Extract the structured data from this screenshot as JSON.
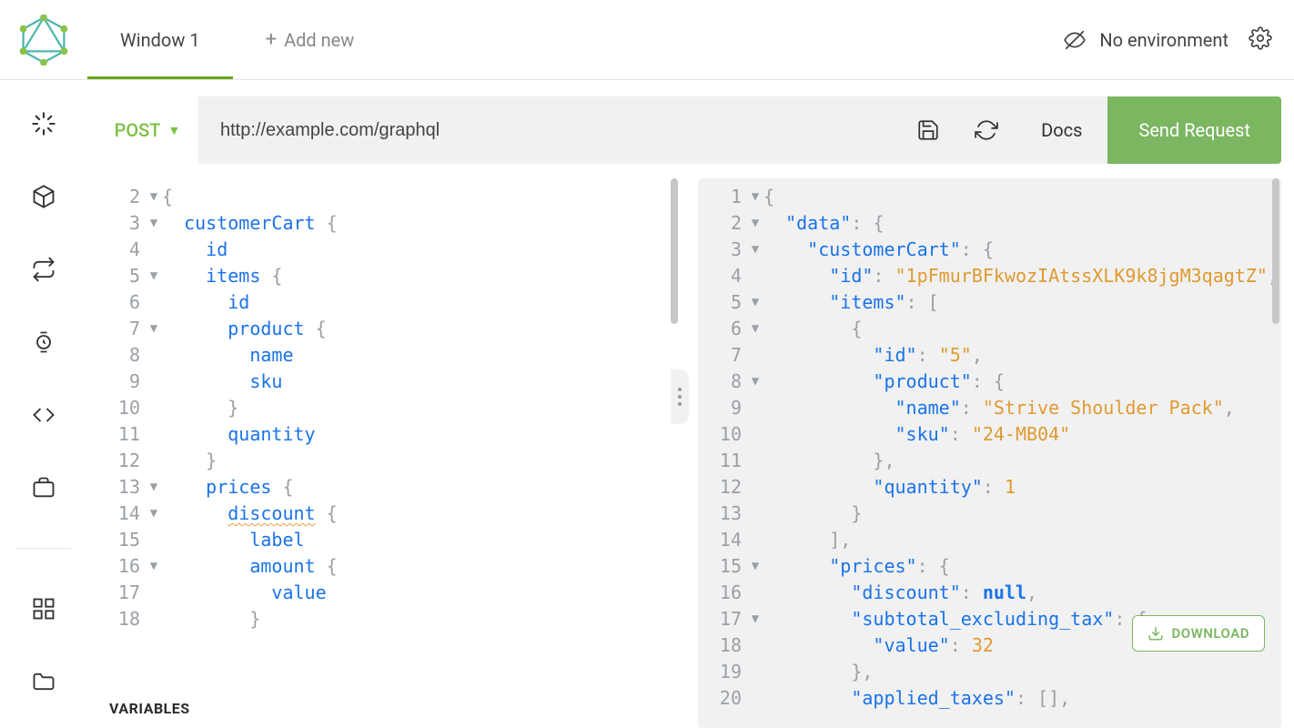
{
  "tabs": {
    "active": "Window 1",
    "add_new_label": "Add new"
  },
  "environment": {
    "label": "No environment"
  },
  "urlbar": {
    "method": "POST",
    "url": "http://example.com/graphql",
    "docs_label": "Docs",
    "send_label": "Send Request"
  },
  "variables_label": "VARIABLES",
  "download_label": "DOWNLOAD",
  "query_lines": [
    {
      "n": 2,
      "fold": true,
      "tokens": [
        {
          "t": "{",
          "c": "pu"
        }
      ]
    },
    {
      "n": 3,
      "fold": true,
      "tokens": [
        {
          "t": "  ",
          "c": ""
        },
        {
          "t": "customerCart",
          "c": "p"
        },
        {
          "t": " {",
          "c": "pu"
        }
      ]
    },
    {
      "n": 4,
      "fold": false,
      "tokens": [
        {
          "t": "    ",
          "c": ""
        },
        {
          "t": "id",
          "c": "p"
        }
      ]
    },
    {
      "n": 5,
      "fold": true,
      "tokens": [
        {
          "t": "    ",
          "c": ""
        },
        {
          "t": "items",
          "c": "p"
        },
        {
          "t": " {",
          "c": "pu"
        }
      ]
    },
    {
      "n": 6,
      "fold": false,
      "tokens": [
        {
          "t": "      ",
          "c": ""
        },
        {
          "t": "id",
          "c": "p"
        }
      ]
    },
    {
      "n": 7,
      "fold": true,
      "tokens": [
        {
          "t": "      ",
          "c": ""
        },
        {
          "t": "product",
          "c": "p"
        },
        {
          "t": " {",
          "c": "pu"
        }
      ]
    },
    {
      "n": 8,
      "fold": false,
      "tokens": [
        {
          "t": "        ",
          "c": ""
        },
        {
          "t": "name",
          "c": "p"
        }
      ]
    },
    {
      "n": 9,
      "fold": false,
      "tokens": [
        {
          "t": "        ",
          "c": ""
        },
        {
          "t": "sku",
          "c": "p"
        }
      ]
    },
    {
      "n": 10,
      "fold": false,
      "tokens": [
        {
          "t": "      ",
          "c": ""
        },
        {
          "t": "}",
          "c": "pu"
        }
      ]
    },
    {
      "n": 11,
      "fold": false,
      "tokens": [
        {
          "t": "      ",
          "c": ""
        },
        {
          "t": "quantity",
          "c": "p"
        }
      ]
    },
    {
      "n": 12,
      "fold": false,
      "tokens": [
        {
          "t": "    ",
          "c": ""
        },
        {
          "t": "}",
          "c": "pu"
        }
      ]
    },
    {
      "n": 13,
      "fold": true,
      "tokens": [
        {
          "t": "    ",
          "c": ""
        },
        {
          "t": "prices",
          "c": "p"
        },
        {
          "t": " {",
          "c": "pu"
        }
      ]
    },
    {
      "n": 14,
      "fold": true,
      "tokens": [
        {
          "t": "      ",
          "c": ""
        },
        {
          "t": "discount",
          "c": "p",
          "u": true
        },
        {
          "t": " {",
          "c": "pu"
        }
      ]
    },
    {
      "n": 15,
      "fold": false,
      "tokens": [
        {
          "t": "        ",
          "c": ""
        },
        {
          "t": "label",
          "c": "p"
        }
      ]
    },
    {
      "n": 16,
      "fold": true,
      "tokens": [
        {
          "t": "        ",
          "c": ""
        },
        {
          "t": "amount",
          "c": "p"
        },
        {
          "t": " {",
          "c": "pu"
        }
      ]
    },
    {
      "n": 17,
      "fold": false,
      "tokens": [
        {
          "t": "          ",
          "c": ""
        },
        {
          "t": "value",
          "c": "p"
        }
      ]
    },
    {
      "n": 18,
      "fold": false,
      "tokens": [
        {
          "t": "        ",
          "c": ""
        },
        {
          "t": "}",
          "c": "pu"
        }
      ]
    }
  ],
  "response_lines": [
    {
      "n": 1,
      "fold": true,
      "tokens": [
        {
          "t": "{",
          "c": "pu"
        }
      ]
    },
    {
      "n": 2,
      "fold": true,
      "tokens": [
        {
          "t": "  ",
          "c": ""
        },
        {
          "t": "\"data\"",
          "c": "k"
        },
        {
          "t": ": {",
          "c": "pu"
        }
      ]
    },
    {
      "n": 3,
      "fold": true,
      "tokens": [
        {
          "t": "    ",
          "c": ""
        },
        {
          "t": "\"customerCart\"",
          "c": "k"
        },
        {
          "t": ": {",
          "c": "pu"
        }
      ]
    },
    {
      "n": 4,
      "fold": false,
      "tokens": [
        {
          "t": "      ",
          "c": ""
        },
        {
          "t": "\"id\"",
          "c": "k"
        },
        {
          "t": ": ",
          "c": "pu"
        },
        {
          "t": "\"1pFmurBFkwozIAtssXLK9k8jgM3qagtZ\"",
          "c": "s"
        },
        {
          "t": ",",
          "c": "pu"
        }
      ]
    },
    {
      "n": 5,
      "fold": true,
      "tokens": [
        {
          "t": "      ",
          "c": ""
        },
        {
          "t": "\"items\"",
          "c": "k"
        },
        {
          "t": ": [",
          "c": "pu"
        }
      ]
    },
    {
      "n": 6,
      "fold": true,
      "tokens": [
        {
          "t": "        ",
          "c": ""
        },
        {
          "t": "{",
          "c": "pu"
        }
      ]
    },
    {
      "n": 7,
      "fold": false,
      "tokens": [
        {
          "t": "          ",
          "c": ""
        },
        {
          "t": "\"id\"",
          "c": "k"
        },
        {
          "t": ": ",
          "c": "pu"
        },
        {
          "t": "\"5\"",
          "c": "s"
        },
        {
          "t": ",",
          "c": "pu"
        }
      ]
    },
    {
      "n": 8,
      "fold": true,
      "tokens": [
        {
          "t": "          ",
          "c": ""
        },
        {
          "t": "\"product\"",
          "c": "k"
        },
        {
          "t": ": {",
          "c": "pu"
        }
      ]
    },
    {
      "n": 9,
      "fold": false,
      "tokens": [
        {
          "t": "            ",
          "c": ""
        },
        {
          "t": "\"name\"",
          "c": "k"
        },
        {
          "t": ": ",
          "c": "pu"
        },
        {
          "t": "\"Strive Shoulder Pack\"",
          "c": "s"
        },
        {
          "t": ",",
          "c": "pu"
        }
      ]
    },
    {
      "n": 10,
      "fold": false,
      "tokens": [
        {
          "t": "            ",
          "c": ""
        },
        {
          "t": "\"sku\"",
          "c": "k"
        },
        {
          "t": ": ",
          "c": "pu"
        },
        {
          "t": "\"24-MB04\"",
          "c": "s"
        }
      ]
    },
    {
      "n": 11,
      "fold": false,
      "tokens": [
        {
          "t": "          ",
          "c": ""
        },
        {
          "t": "},",
          "c": "pu"
        }
      ]
    },
    {
      "n": 12,
      "fold": false,
      "tokens": [
        {
          "t": "          ",
          "c": ""
        },
        {
          "t": "\"quantity\"",
          "c": "k"
        },
        {
          "t": ": ",
          "c": "pu"
        },
        {
          "t": "1",
          "c": "n"
        }
      ]
    },
    {
      "n": 13,
      "fold": false,
      "tokens": [
        {
          "t": "        ",
          "c": ""
        },
        {
          "t": "}",
          "c": "pu"
        }
      ]
    },
    {
      "n": 14,
      "fold": false,
      "tokens": [
        {
          "t": "      ",
          "c": ""
        },
        {
          "t": "],",
          "c": "pu"
        }
      ]
    },
    {
      "n": 15,
      "fold": true,
      "tokens": [
        {
          "t": "      ",
          "c": ""
        },
        {
          "t": "\"prices\"",
          "c": "k"
        },
        {
          "t": ": {",
          "c": "pu"
        }
      ]
    },
    {
      "n": 16,
      "fold": false,
      "tokens": [
        {
          "t": "        ",
          "c": ""
        },
        {
          "t": "\"discount\"",
          "c": "k"
        },
        {
          "t": ": ",
          "c": "pu"
        },
        {
          "t": "null",
          "c": "b"
        },
        {
          "t": ",",
          "c": "pu"
        }
      ]
    },
    {
      "n": 17,
      "fold": true,
      "tokens": [
        {
          "t": "        ",
          "c": ""
        },
        {
          "t": "\"subtotal_excluding_tax\"",
          "c": "k"
        },
        {
          "t": ": {",
          "c": "pu"
        }
      ]
    },
    {
      "n": 18,
      "fold": false,
      "tokens": [
        {
          "t": "          ",
          "c": ""
        },
        {
          "t": "\"value\"",
          "c": "k"
        },
        {
          "t": ": ",
          "c": "pu"
        },
        {
          "t": "32",
          "c": "n"
        }
      ]
    },
    {
      "n": 19,
      "fold": false,
      "tokens": [
        {
          "t": "        ",
          "c": ""
        },
        {
          "t": "},",
          "c": "pu"
        }
      ]
    },
    {
      "n": 20,
      "fold": false,
      "tokens": [
        {
          "t": "        ",
          "c": ""
        },
        {
          "t": "\"applied_taxes\"",
          "c": "k"
        },
        {
          "t": ": [],",
          "c": "pu"
        }
      ]
    }
  ]
}
